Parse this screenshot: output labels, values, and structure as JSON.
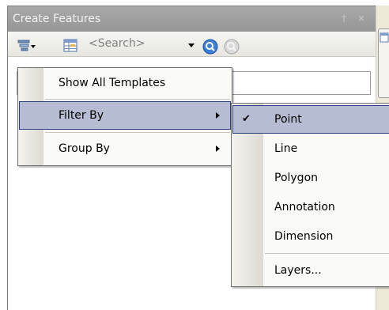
{
  "window": {
    "title": "Create Features",
    "pin_glyph": "†",
    "close_glyph": "×"
  },
  "toolbar": {
    "search_placeholder": "<Search>",
    "icons": [
      "organize-templates-icon",
      "templates-table-icon",
      "search-icon",
      "clear-search-icon"
    ]
  },
  "menu": {
    "items": [
      {
        "label": "Show All Templates",
        "submenu": false
      },
      {
        "label": "Filter By",
        "submenu": true,
        "highlighted": true
      },
      {
        "label": "Group By",
        "submenu": true
      }
    ]
  },
  "submenu": {
    "items": [
      {
        "label": "Point",
        "checked": true,
        "highlighted": true
      },
      {
        "label": "Line"
      },
      {
        "label": "Polygon"
      },
      {
        "label": "Annotation"
      },
      {
        "label": "Dimension"
      },
      {
        "label": "Layers..."
      }
    ],
    "check_glyph": "✔"
  },
  "colors": {
    "highlight": "#b6bdd2",
    "highlight_border": "#2d3d7a",
    "titlebar": "#a0a0a0"
  }
}
